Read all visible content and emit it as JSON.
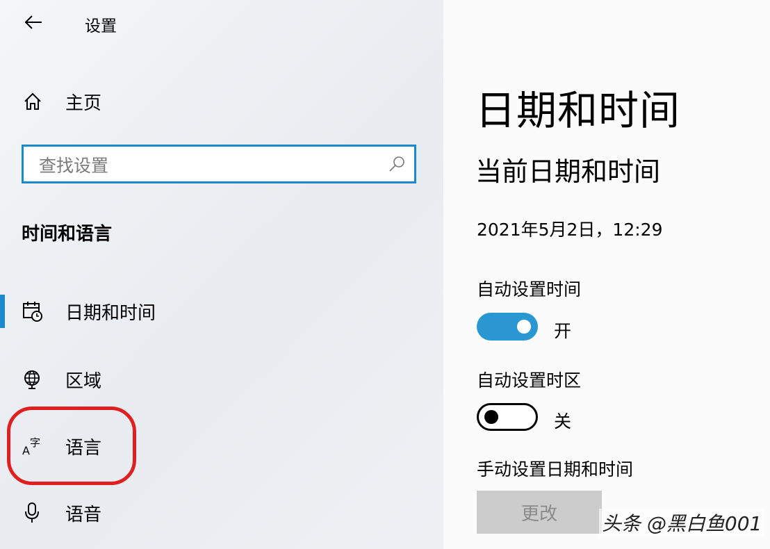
{
  "header": {
    "title": "设置"
  },
  "sidebar": {
    "home_label": "主页",
    "search_placeholder": "查找设置",
    "section_heading": "时间和语言",
    "items": [
      {
        "label": "日期和时间",
        "icon": "calendar-clock-icon"
      },
      {
        "label": "区域",
        "icon": "globe-icon"
      },
      {
        "label": "语言",
        "icon": "language-icon"
      },
      {
        "label": "语音",
        "icon": "microphone-icon"
      }
    ]
  },
  "main": {
    "page_title": "日期和时间",
    "current_heading": "当前日期和时间",
    "current_datetime": "2021年5月2日，12:29",
    "auto_time": {
      "label": "自动设置时间",
      "state": "开",
      "on": true
    },
    "auto_timezone": {
      "label": "自动设置时区",
      "state": "关",
      "on": false
    },
    "manual": {
      "label": "手动设置日期和时间",
      "button": "更改"
    }
  },
  "watermark": "头条 @黑白鱼001",
  "colors": {
    "accent": "#1a8ad0",
    "highlight": "#e02020",
    "toggle_on": "#2a97d3"
  }
}
